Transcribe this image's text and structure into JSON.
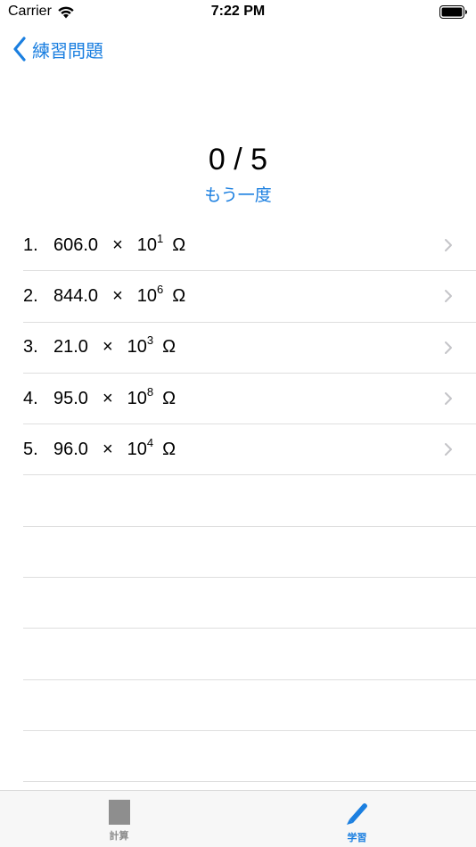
{
  "status_bar": {
    "carrier": "Carrier",
    "time": "7:22 PM"
  },
  "nav": {
    "back_label": "練習問題"
  },
  "score": {
    "text": "0 / 5",
    "retry_label": "もう一度"
  },
  "items": [
    {
      "index": "1.",
      "mantissa": "606.0",
      "times": "×",
      "base": "10",
      "exponent": "1",
      "unit": "Ω"
    },
    {
      "index": "2.",
      "mantissa": "844.0",
      "times": "×",
      "base": "10",
      "exponent": "6",
      "unit": "Ω"
    },
    {
      "index": "3.",
      "mantissa": "21.0",
      "times": "×",
      "base": "10",
      "exponent": "3",
      "unit": "Ω"
    },
    {
      "index": "4.",
      "mantissa": "95.0",
      "times": "×",
      "base": "10",
      "exponent": "8",
      "unit": "Ω"
    },
    {
      "index": "5.",
      "mantissa": "96.0",
      "times": "×",
      "base": "10",
      "exponent": "4",
      "unit": "Ω"
    }
  ],
  "tabs": [
    {
      "label": "計算",
      "icon": "calculator-icon",
      "active": false
    },
    {
      "label": "学習",
      "icon": "pencil-icon",
      "active": true
    }
  ],
  "colors": {
    "accent": "#1b7fe0",
    "separator": "#dedede",
    "chevron": "#c4c4c8"
  }
}
